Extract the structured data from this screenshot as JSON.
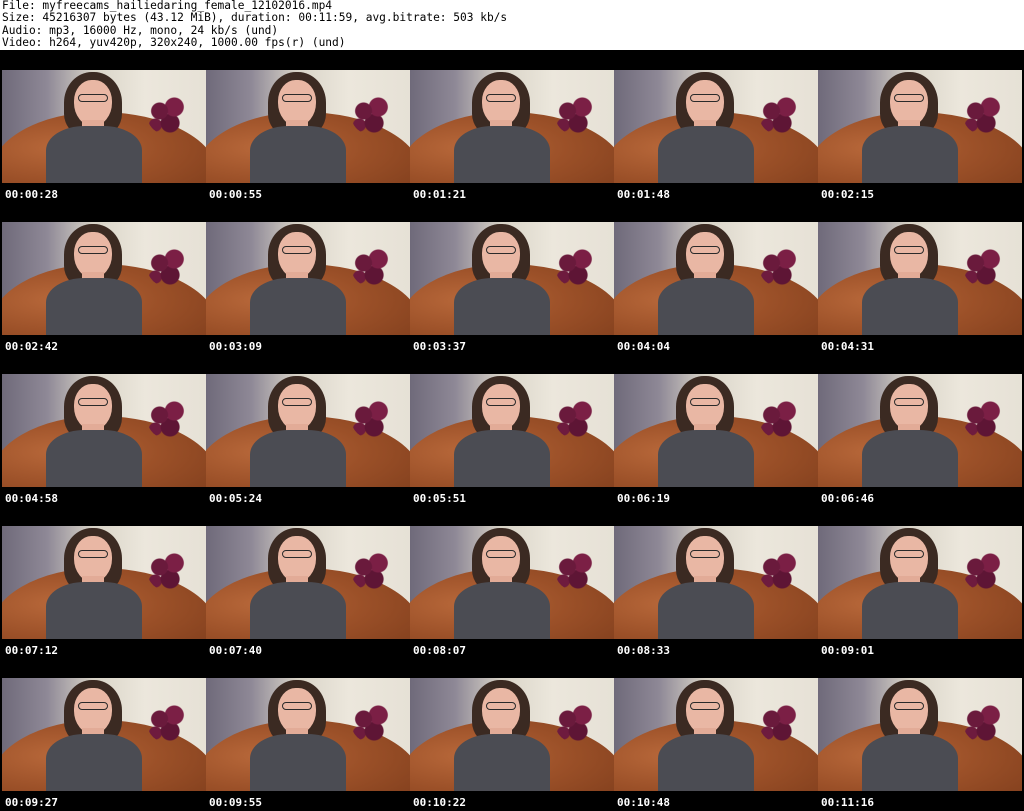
{
  "header": {
    "file_line": "File: myfreecams_hailiedaring_female_12102016.mp4",
    "size_line": "Size: 45216307 bytes (43.12 MiB), duration: 00:11:59, avg.bitrate: 503 kb/s",
    "audio_line": "Audio: mp3, 16000 Hz, mono, 24 kb/s (und)",
    "video_line": "Video: h264, yuv420p, 320x240, 1000.00 fps(r) (und)"
  },
  "frames": [
    "00:00:28",
    "00:00:55",
    "00:01:21",
    "00:01:48",
    "00:02:15",
    "00:02:42",
    "00:03:09",
    "00:03:37",
    "00:04:04",
    "00:04:31",
    "00:04:58",
    "00:05:24",
    "00:05:51",
    "00:06:19",
    "00:06:46",
    "00:07:12",
    "00:07:40",
    "00:08:07",
    "00:08:33",
    "00:09:01",
    "00:09:27",
    "00:09:55",
    "00:10:22",
    "00:10:48",
    "00:11:16"
  ]
}
